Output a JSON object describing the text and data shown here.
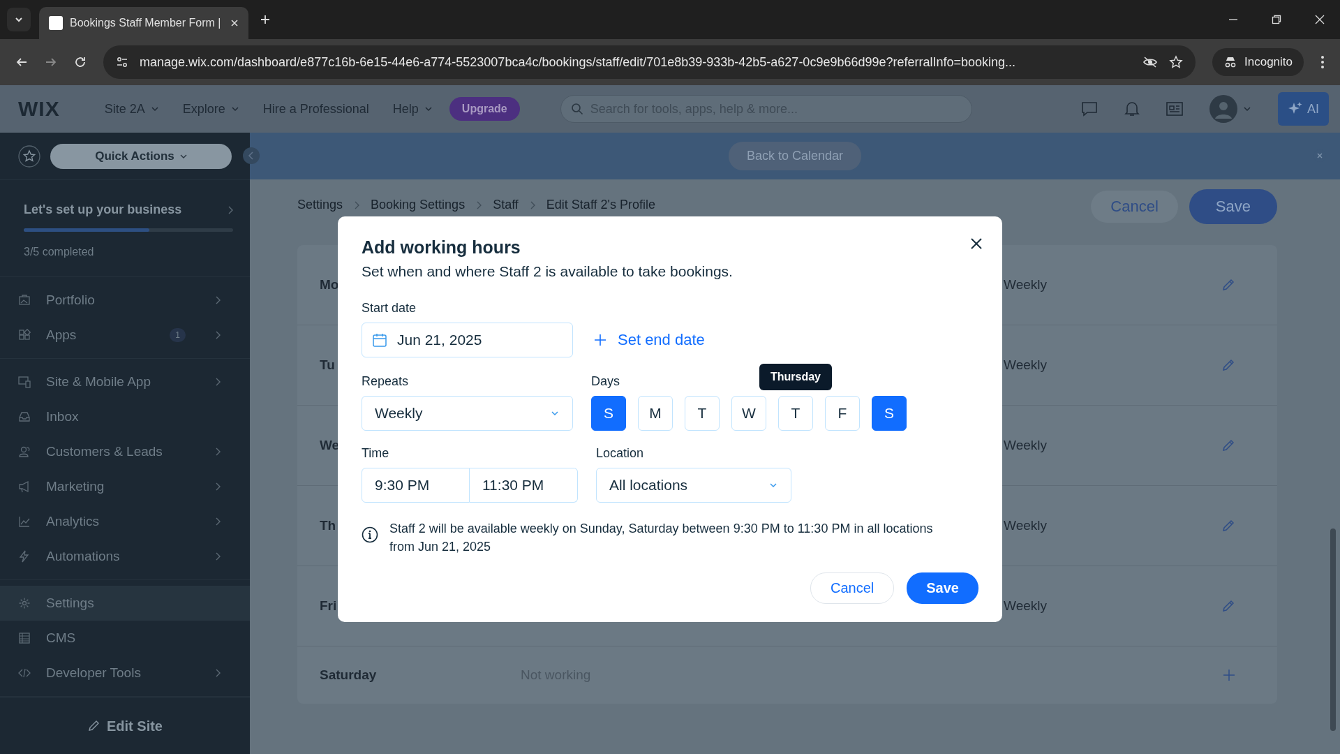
{
  "browser": {
    "tabs": [
      {
        "title": "Bookings Staff Member Form | ",
        "selected": true
      }
    ],
    "url": "manage.wix.com/dashboard/e877c16b-6e15-44e6-a774-5523007bca4c/bookings/staff/edit/701e8b39-933b-42b5-a627-0c9e9b66d99e?referralInfo=booking...",
    "profile": "Incognito"
  },
  "header": {
    "logo": "WIX",
    "nav": [
      {
        "label": "Site 2A",
        "dropdown": true
      },
      {
        "label": "Explore",
        "dropdown": true
      },
      {
        "label": "Hire a Professional",
        "dropdown": false
      },
      {
        "label": "Help",
        "dropdown": true
      }
    ],
    "upgrade": "Upgrade",
    "search_placeholder": "Search for tools, apps, help & more...",
    "ai": "AI"
  },
  "sidebar": {
    "quick_actions": "Quick Actions",
    "setup": {
      "title": "Let's set up your business",
      "level": 0.6,
      "progress": "3/5 completed"
    },
    "groups": [
      [
        {
          "label": "Portfolio",
          "chevron": true,
          "selected": false
        },
        {
          "label": "Apps",
          "badge": "1",
          "chevron": true,
          "selected": false
        }
      ],
      [
        {
          "label": "Site & Mobile App",
          "chevron": true,
          "selected": false
        },
        {
          "label": "Inbox",
          "chevron": false,
          "selected": false
        },
        {
          "label": "Customers & Leads",
          "chevron": true,
          "selected": false
        },
        {
          "label": "Marketing",
          "chevron": true,
          "selected": false
        },
        {
          "label": "Analytics",
          "chevron": true,
          "selected": false
        },
        {
          "label": "Automations",
          "chevron": true,
          "selected": false
        }
      ],
      [
        {
          "label": "Settings",
          "chevron": false,
          "selected": true
        },
        {
          "label": "CMS",
          "chevron": false,
          "selected": false
        },
        {
          "label": "Developer Tools",
          "chevron": true,
          "selected": false
        }
      ]
    ],
    "edit_site": "Edit Site"
  },
  "banner": {
    "button": "Back to Calendar"
  },
  "page": {
    "breadcrumbs": [
      "Settings",
      "Booking Settings",
      "Staff",
      "Edit Staff 2's Profile"
    ],
    "cancel": "Cancel",
    "save": "Save",
    "rows": [
      {
        "kind": "working",
        "day": "Mo",
        "repeat": "Weekly"
      },
      {
        "kind": "working",
        "day": "Tu",
        "repeat": "Weekly"
      },
      {
        "kind": "working",
        "day": "We",
        "repeat": "Weekly"
      },
      {
        "kind": "working",
        "day": "Th",
        "repeat": "Weekly"
      },
      {
        "kind": "working",
        "day": "Fri",
        "repeat": "Weekly"
      },
      {
        "kind": "off",
        "day": "Saturday",
        "status": "Not working"
      }
    ]
  },
  "modal": {
    "title": "Add working hours",
    "subtitle": "Set when and where Staff 2 is available to take bookings.",
    "start_date_label": "Start date",
    "start_date": "Jun 21, 2025",
    "set_end_date": "Set end date",
    "repeats_label": "Repeats",
    "repeats": "Weekly",
    "days_label": "Days",
    "days": [
      {
        "letter": "S",
        "selected": true
      },
      {
        "letter": "M",
        "selected": false
      },
      {
        "letter": "T",
        "selected": false
      },
      {
        "letter": "W",
        "selected": false
      },
      {
        "letter": "T",
        "selected": false,
        "tooltip": "Thursday"
      },
      {
        "letter": "F",
        "selected": false
      },
      {
        "letter": "S",
        "selected": true
      }
    ],
    "time_label": "Time",
    "start_time": "9:30 PM",
    "end_time": "11:30 PM",
    "location_label": "Location",
    "location": "All locations",
    "info": "Staff 2 will be available weekly on Sunday, Saturday between 9:30 PM to 11:30 PM in all locations from Jun 21, 2025",
    "cancel": "Cancel",
    "save": "Save"
  }
}
